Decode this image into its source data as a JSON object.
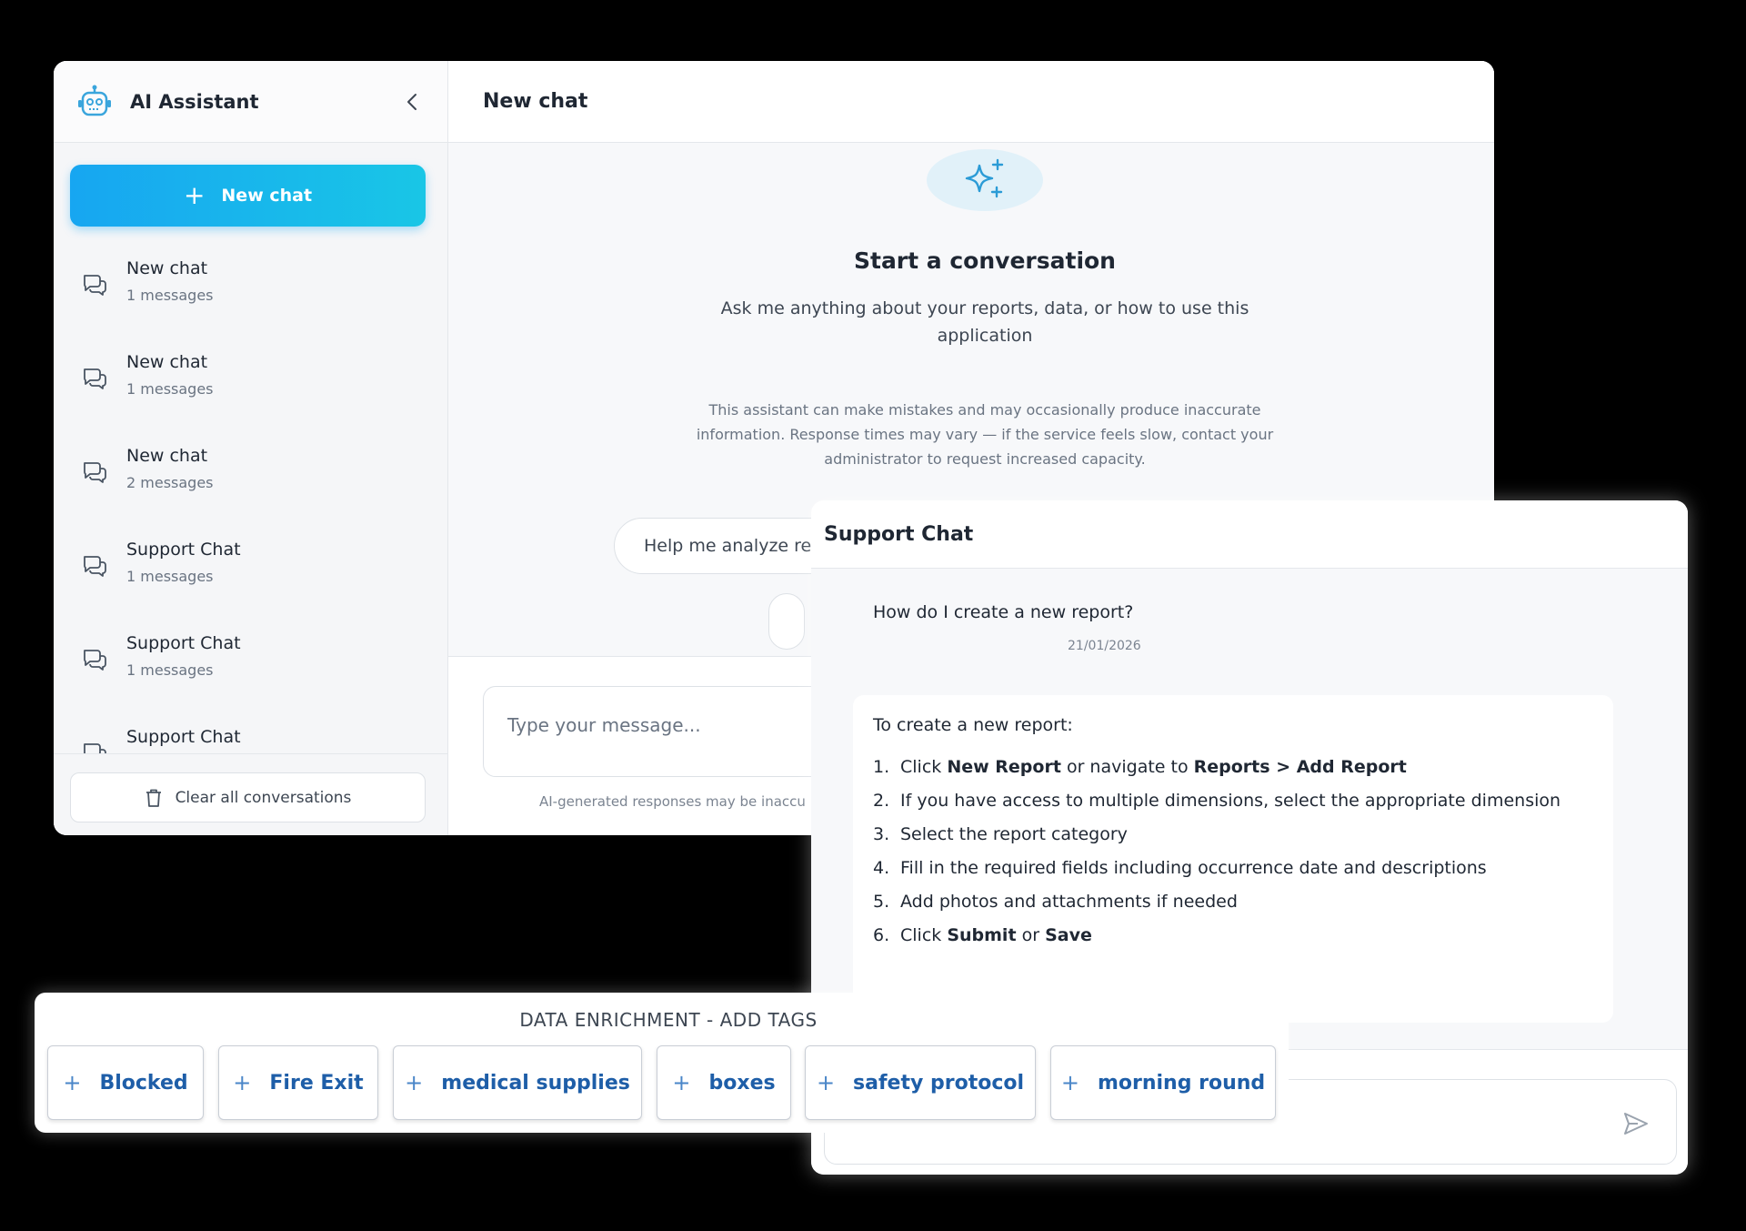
{
  "app": {
    "title": "AI Assistant"
  },
  "sidebar": {
    "new_chat_label": "New chat",
    "conversations": [
      {
        "title": "New chat",
        "count": "1 messages"
      },
      {
        "title": "New chat",
        "count": "1 messages"
      },
      {
        "title": "New chat",
        "count": "2 messages"
      },
      {
        "title": "Support Chat",
        "count": "1 messages"
      },
      {
        "title": "Support Chat",
        "count": "1 messages"
      },
      {
        "title": "Support Chat",
        "count": ""
      }
    ],
    "clear_label": "Clear all conversations"
  },
  "chat": {
    "title": "New chat",
    "empty_title": "Start a conversation",
    "empty_subtitle": "Ask me anything about your reports, data, or how to use this application",
    "disclaimer": "This assistant can make mistakes and may occasionally produce inaccurate information. Response times may vary — if the service feels slow, contact your administrator to request increased capacity.",
    "suggestion": "Help me analyze re",
    "input_placeholder": "Type your message...",
    "ai_note": "AI-generated responses may be inaccu"
  },
  "support": {
    "title": "Support Chat",
    "user_message": "How do I create a new report?",
    "date": "21/01/2026",
    "assistant_intro": "To create a new report:",
    "steps": [
      {
        "num": "1.",
        "pre": "Click ",
        "b1": "New Report",
        "mid": " or navigate to ",
        "b2": "Reports > Add Report",
        "post": ""
      },
      {
        "num": "2.",
        "pre": "If you have access to multiple dimensions, select the appropriate dimension",
        "b1": "",
        "mid": "",
        "b2": "",
        "post": ""
      },
      {
        "num": "3.",
        "pre": "Select the report category",
        "b1": "",
        "mid": "",
        "b2": "",
        "post": ""
      },
      {
        "num": "4.",
        "pre": "Fill in the required fields including occurrence date and descriptions",
        "b1": "",
        "mid": "",
        "b2": "",
        "post": ""
      },
      {
        "num": "5.",
        "pre": "Add photos and attachments if needed",
        "b1": "",
        "mid": "",
        "b2": "",
        "post": ""
      },
      {
        "num": "6.",
        "pre": "Click ",
        "b1": "Submit",
        "mid": " or ",
        "b2": "Save",
        "post": ""
      }
    ]
  },
  "enrichment": {
    "title": "DATA ENRICHMENT - ADD TAGS",
    "tags": [
      "Blocked",
      "Fire Exit",
      "medical supplies",
      "boxes",
      "safety protocol",
      "morning round"
    ]
  },
  "colors": {
    "accent_start": "#17a6f1",
    "accent_end": "#19c6e6",
    "tag_text": "#1e5ea8",
    "page_bg": "#000000"
  },
  "icons": {
    "app": "robot-icon",
    "collapse": "chevron-left-icon",
    "conversation": "chat-bubbles-icon",
    "clear": "trash-icon",
    "empty_state": "sparkles-icon",
    "send": "send-icon",
    "tag": "plus-icon"
  }
}
